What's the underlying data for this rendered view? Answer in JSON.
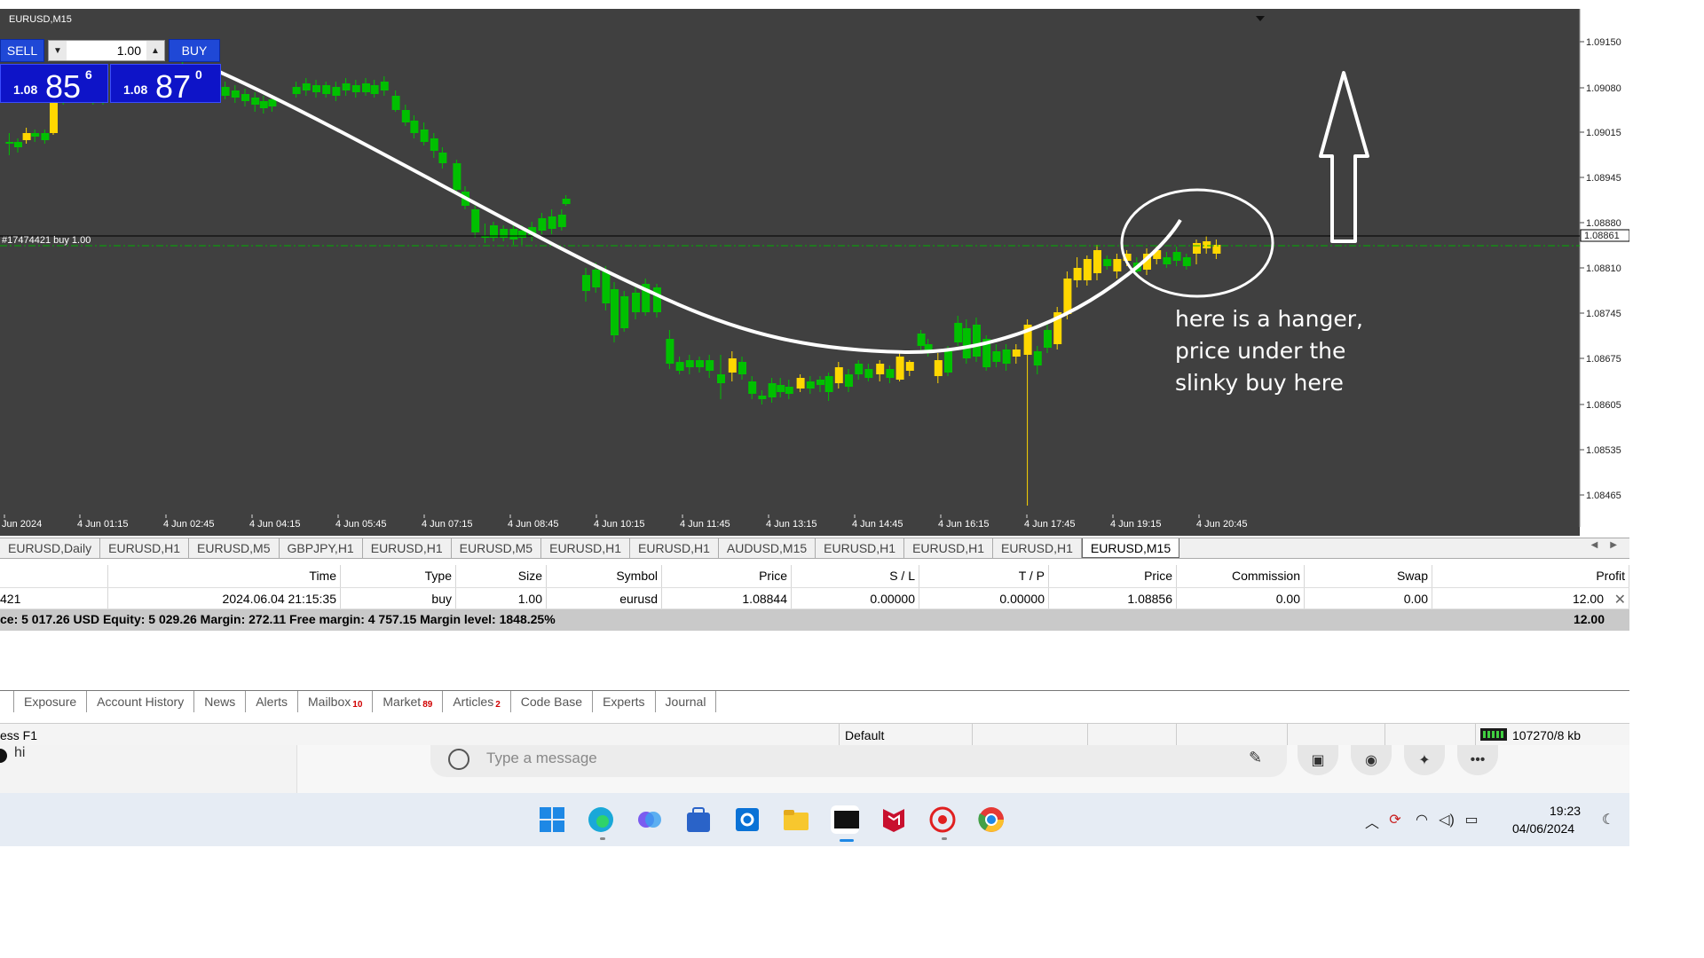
{
  "chart": {
    "window_title": "EURUSD,M15",
    "order_line_label": "#17474421 buy 1.00",
    "current_price_label": "1.08861",
    "price_axis": [
      "1.09150",
      "1.09080",
      "1.09015",
      "1.08945",
      "1.08880",
      "1.08810",
      "1.08745",
      "1.08675",
      "1.08605",
      "1.08535",
      "1.08465"
    ],
    "time_axis": [
      "Jun 2024",
      "4 Jun 01:15",
      "4 Jun 02:45",
      "4 Jun 04:15",
      "4 Jun 05:45",
      "4 Jun 07:15",
      "4 Jun 08:45",
      "4 Jun 10:15",
      "4 Jun 11:45",
      "4 Jun 13:15",
      "4 Jun 14:45",
      "4 Jun 16:15",
      "4 Jun 17:45",
      "4 Jun 19:15",
      "4 Jun 20:45"
    ],
    "bull_color": "#00c000",
    "bear_color": "#ffd700",
    "background_color": "#404040",
    "annotation_lines": [
      "here is a hanger,",
      "price under the",
      "slinky buy here"
    ]
  },
  "trade_panel": {
    "sell_label": "SELL",
    "buy_label": "BUY",
    "lot_value": "1.00",
    "sell_small": "1.08",
    "sell_big": "85",
    "sell_sup": "6",
    "buy_small": "1.08",
    "buy_big": "87",
    "buy_sup": "0"
  },
  "chart_tabs": [
    {
      "label": "EURUSD,Daily",
      "active": false
    },
    {
      "label": "EURUSD,H1",
      "active": false
    },
    {
      "label": "EURUSD,M5",
      "active": false
    },
    {
      "label": "GBPJPY,H1",
      "active": false
    },
    {
      "label": "EURUSD,H1",
      "active": false
    },
    {
      "label": "EURUSD,M5",
      "active": false
    },
    {
      "label": "EURUSD,H1",
      "active": false
    },
    {
      "label": "EURUSD,H1",
      "active": false
    },
    {
      "label": "AUDUSD,M15",
      "active": false
    },
    {
      "label": "EURUSD,H1",
      "active": false
    },
    {
      "label": "EURUSD,H1",
      "active": false
    },
    {
      "label": "EURUSD,H1",
      "active": false
    },
    {
      "label": "EURUSD,M15",
      "active": true
    }
  ],
  "trades": {
    "headers": [
      "",
      "Time",
      "Type",
      "Size",
      "Symbol",
      "Price",
      "S / L",
      "T / P",
      "Price",
      "Commission",
      "Swap",
      "Profit"
    ],
    "rows": [
      [
        "421",
        "2024.06.04 21:15:35",
        "buy",
        "1.00",
        "eurusd",
        "1.08844",
        "0.00000",
        "0.00000",
        "1.08856",
        "0.00",
        "0.00",
        "12.00"
      ]
    ],
    "balance_text": "ce: 5 017.26 USD  Equity: 5 029.26  Margin: 272.11  Free margin: 4 757.15  Margin level: 1848.25%",
    "balance_profit": "12.00"
  },
  "terminal_tabs": [
    {
      "label": "Exposure",
      "badge": ""
    },
    {
      "label": "Account History",
      "badge": ""
    },
    {
      "label": "News",
      "badge": ""
    },
    {
      "label": "Alerts",
      "badge": ""
    },
    {
      "label": "Mailbox",
      "badge": "10"
    },
    {
      "label": "Market",
      "badge": "89"
    },
    {
      "label": "Articles",
      "badge": "2"
    },
    {
      "label": "Code Base",
      "badge": ""
    },
    {
      "label": "Experts",
      "badge": ""
    },
    {
      "label": "Journal",
      "badge": ""
    }
  ],
  "status": {
    "help_text": "ess F1",
    "profile": "Default",
    "connection": "107270/8 kb"
  },
  "chat": {
    "message": "hi",
    "placeholder": "Type a message"
  },
  "taskbar": {
    "time": "19:23",
    "date": "04/06/2024"
  }
}
